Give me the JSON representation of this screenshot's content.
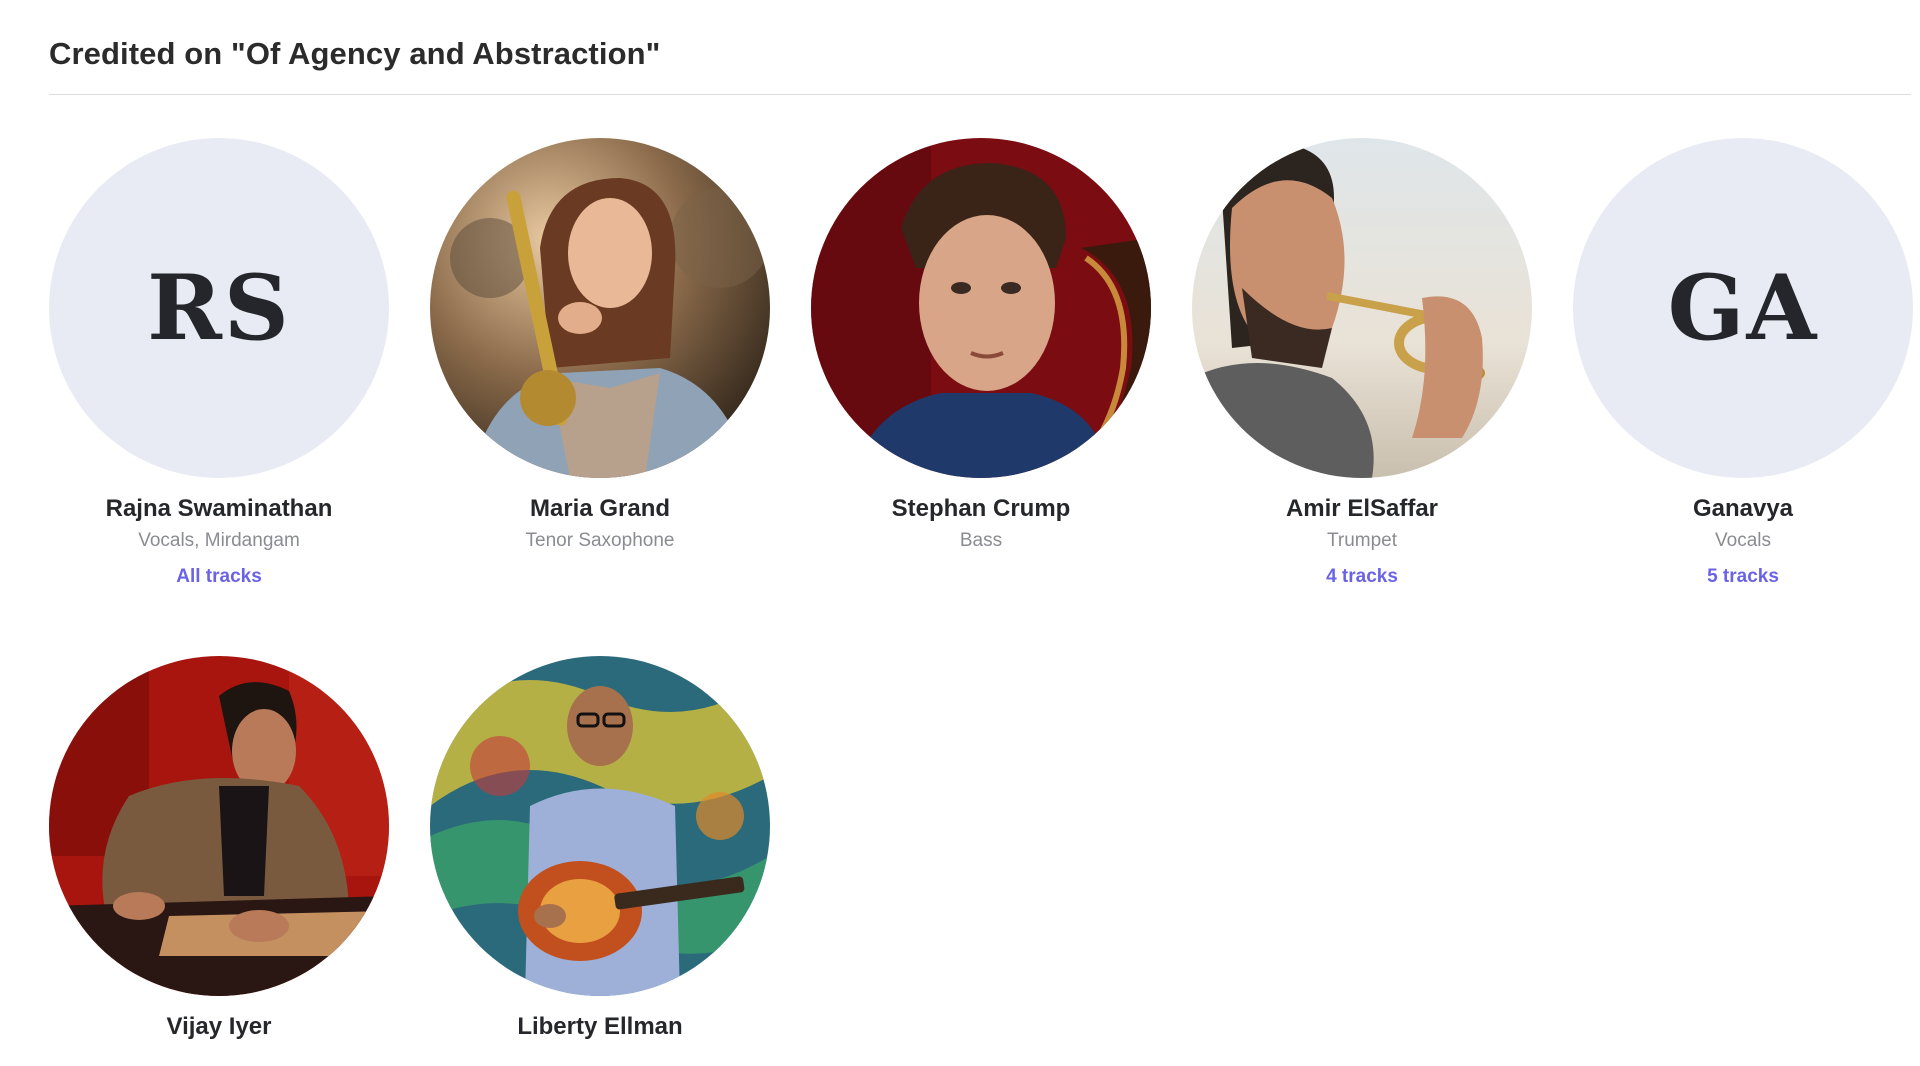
{
  "section": {
    "title": "Credited on \"Of Agency and Abstraction\""
  },
  "credits": [
    {
      "name": "Rajna Swaminathan",
      "role": "Vocals, Mirdangam",
      "tracks": "All tracks",
      "initials": "RS",
      "avatar": "initials-avatar"
    },
    {
      "name": "Maria Grand",
      "role": "Tenor Saxophone",
      "avatar": "photo-saxophonist"
    },
    {
      "name": "Stephan Crump",
      "role": "Bass",
      "avatar": "photo-bassist"
    },
    {
      "name": "Amir ElSaffar",
      "role": "Trumpet",
      "tracks": "4 tracks",
      "avatar": "photo-trumpeter"
    },
    {
      "name": "Ganavya",
      "role": "Vocals",
      "tracks": "5 tracks",
      "initials": "GA",
      "avatar": "initials-avatar"
    },
    {
      "name": "Vijay Iyer",
      "avatar": "photo-pianist"
    },
    {
      "name": "Liberty Ellman",
      "avatar": "photo-guitarist"
    }
  ],
  "colors": {
    "link": "#6b63e6",
    "initials_bg": "#e8ebf3",
    "divider": "#dcdde2"
  }
}
